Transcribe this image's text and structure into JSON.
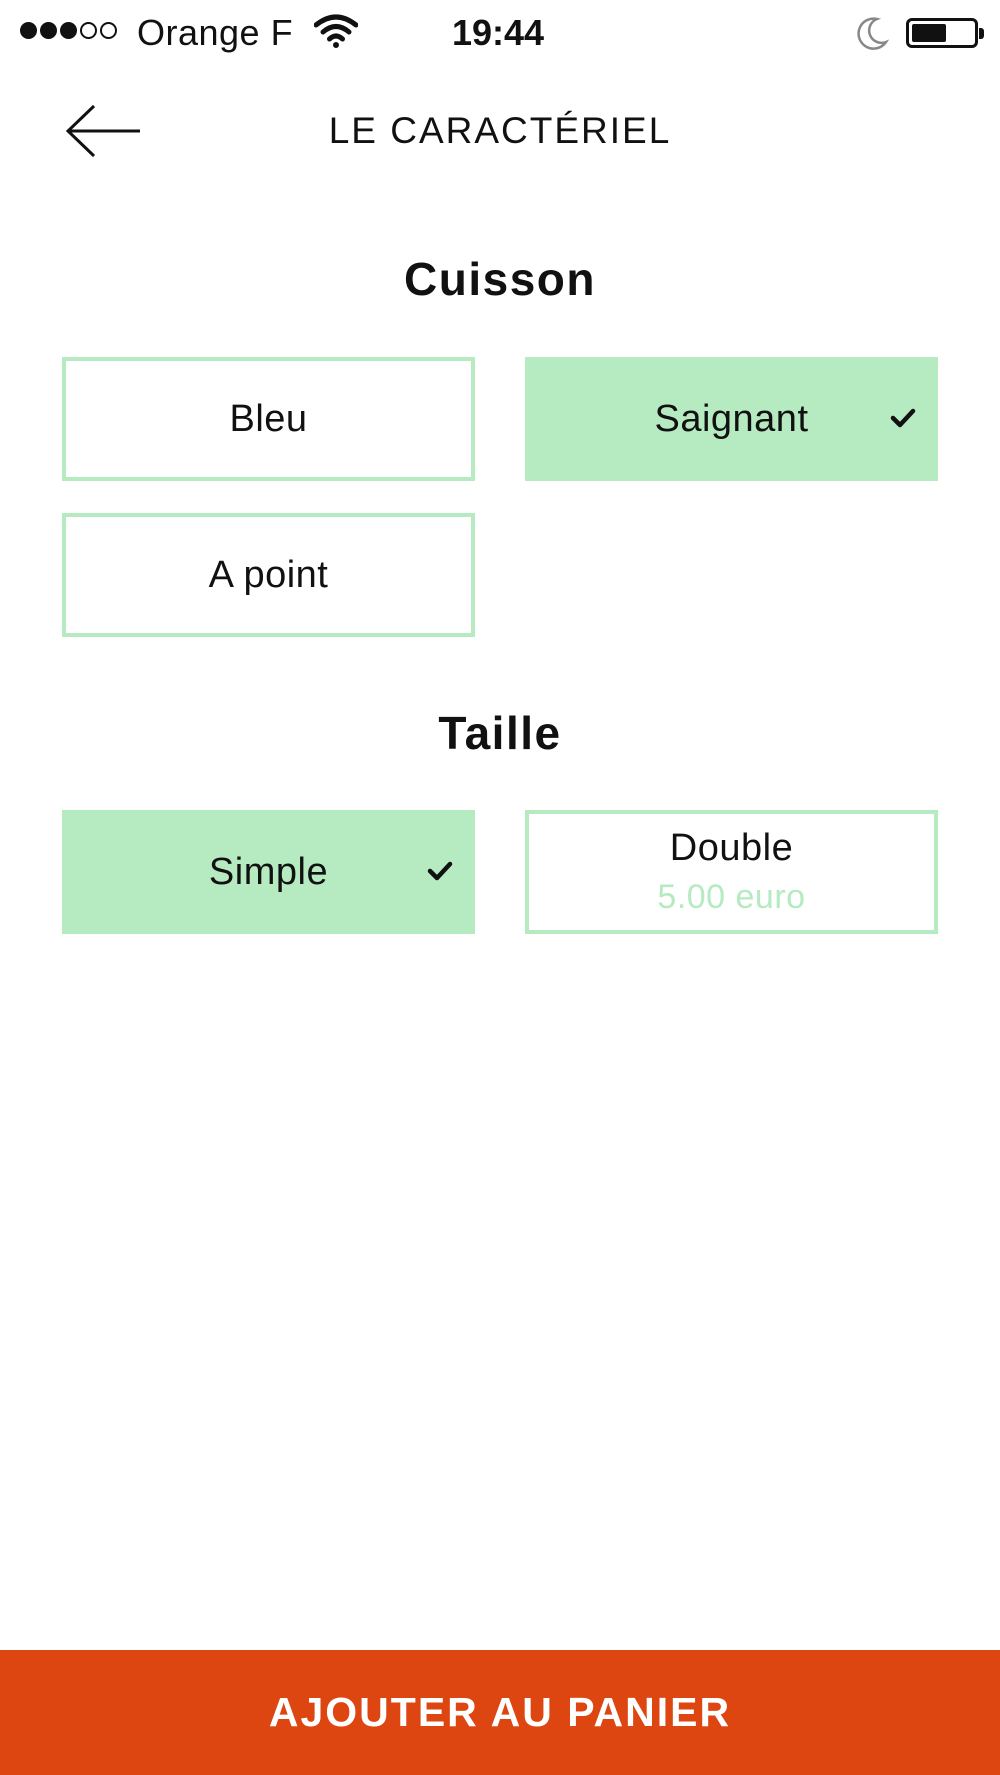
{
  "status_bar": {
    "carrier": "Orange F",
    "time": "19:44",
    "signal_bars_filled": 3,
    "signal_bars_total": 5
  },
  "header": {
    "title": "LE CARACTÉRIEL",
    "back_icon": "arrow-left-icon"
  },
  "sections": [
    {
      "title": "Cuisson",
      "options": [
        {
          "label": "Bleu",
          "selected": false
        },
        {
          "label": "Saignant",
          "selected": true
        },
        {
          "label": "A point",
          "selected": false
        }
      ]
    },
    {
      "title": "Taille",
      "options": [
        {
          "label": "Simple",
          "selected": true
        },
        {
          "label": "Double",
          "price": "5.00 euro",
          "selected": false
        }
      ]
    }
  ],
  "cta": {
    "add_to_cart_label": "AJOUTER AU PANIER"
  },
  "colors": {
    "accent_green": "#b6eac0",
    "cta_orange": "#dd4511"
  }
}
